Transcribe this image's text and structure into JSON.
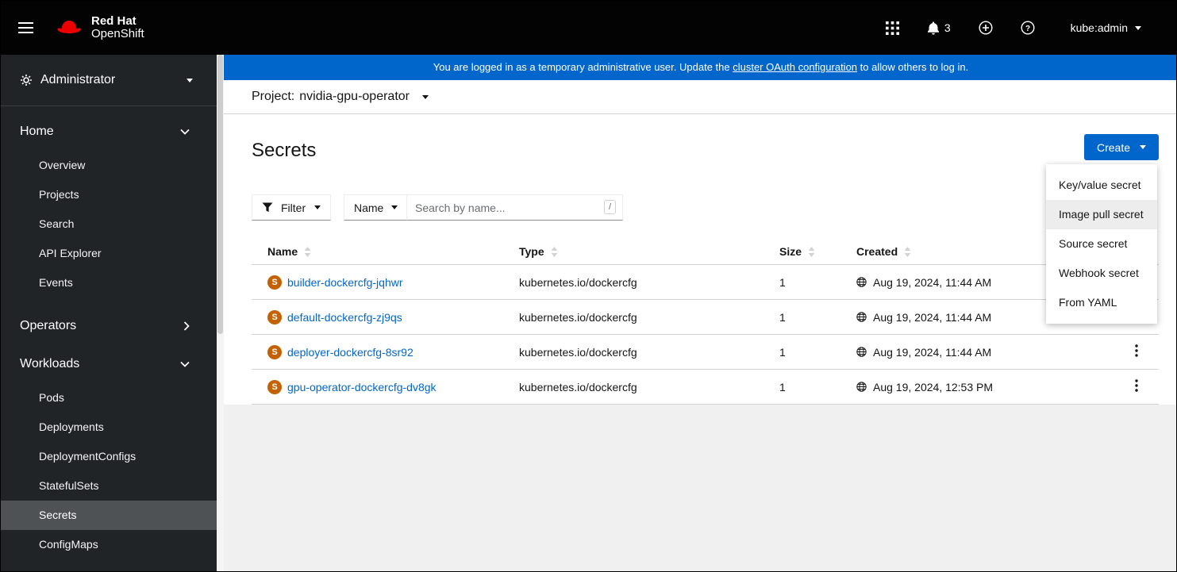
{
  "masthead": {
    "brand": {
      "line1": "Red Hat",
      "line2": "OpenShift"
    },
    "notification_count": "3",
    "user": "kube:admin"
  },
  "sidebar": {
    "perspective": "Administrator",
    "sections": [
      {
        "label": "Home",
        "expanded": true,
        "items": [
          "Overview",
          "Projects",
          "Search",
          "API Explorer",
          "Events"
        ]
      },
      {
        "label": "Operators",
        "expanded": false,
        "items": []
      },
      {
        "label": "Workloads",
        "expanded": true,
        "active_item": "Secrets",
        "items": [
          "Pods",
          "Deployments",
          "DeploymentConfigs",
          "StatefulSets",
          "Secrets",
          "ConfigMaps"
        ]
      }
    ]
  },
  "banner": {
    "text_before": "You are logged in as a temporary administrative user. Update the ",
    "link": "cluster OAuth configuration",
    "text_after": " to allow others to log in."
  },
  "project_bar": {
    "label": "Project:",
    "value": "nvidia-gpu-operator"
  },
  "page": {
    "title": "Secrets",
    "create_button": "Create",
    "create_menu": {
      "items": [
        "Key/value secret",
        "Image pull secret",
        "Source secret",
        "Webhook secret",
        "From YAML"
      ],
      "highlighted": "Image pull secret"
    },
    "toolbar": {
      "filter_label": "Filter",
      "name_label": "Name",
      "search_placeholder": "Search by name...",
      "shortcut": "/"
    },
    "table": {
      "columns": [
        "Name",
        "Type",
        "Size",
        "Created"
      ],
      "secret_badge": "S",
      "rows": [
        {
          "name": "builder-dockercfg-jqhwr",
          "type": "kubernetes.io/dockercfg",
          "size": "1",
          "created": "Aug 19, 2024, 11:44 AM"
        },
        {
          "name": "default-dockercfg-zj9qs",
          "type": "kubernetes.io/dockercfg",
          "size": "1",
          "created": "Aug 19, 2024, 11:44 AM"
        },
        {
          "name": "deployer-dockercfg-8sr92",
          "type": "kubernetes.io/dockercfg",
          "size": "1",
          "created": "Aug 19, 2024, 11:44 AM"
        },
        {
          "name": "gpu-operator-dockercfg-dv8gk",
          "type": "kubernetes.io/dockercfg",
          "size": "1",
          "created": "Aug 19, 2024, 12:53 PM"
        }
      ]
    }
  },
  "colors": {
    "masthead_bg": "#030303",
    "sidebar_bg": "#212427",
    "active_nav_bg": "#4f5255",
    "banner_bg": "#0066cc",
    "accent_blue": "#0066cc",
    "link": "#0066cc",
    "secret_badge_bg": "#c46100",
    "brand_red": "#ee0000"
  }
}
